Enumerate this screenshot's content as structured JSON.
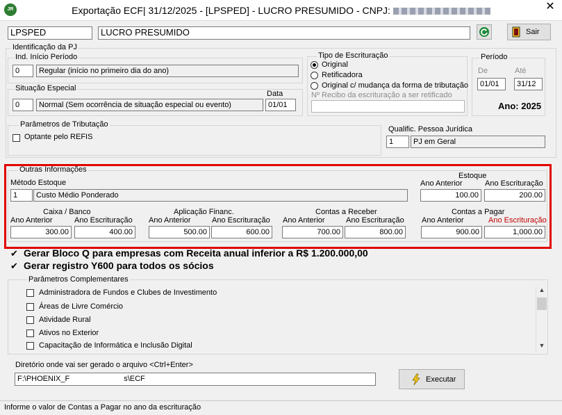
{
  "titlebar": {
    "icon_text": "JR",
    "title": "Exportação ECF| 31/12/2025 - [LPSPED] - LUCRO PRESUMIDO - CNPJ:",
    "close": "✕"
  },
  "header": {
    "code": "LPSPED",
    "name": "LUCRO PRESUMIDO",
    "exit_button": "Sair"
  },
  "identificacao": {
    "legend": "Identificação da PJ",
    "ind_inicio": {
      "legend": "Ind. Início Período",
      "code": "0",
      "desc": "Regular (início no primeiro dia do ano)"
    },
    "situacao": {
      "legend": "Situação Especial",
      "date_label": "Data",
      "code": "0",
      "desc": "Normal (Sem ocorrência de situação especial ou evento)",
      "date": "01/01"
    },
    "tipo": {
      "legend": "Tipo de Escrituração",
      "options": [
        "Original",
        "Retificadora",
        "Original c/ mudança da forma de tributação"
      ],
      "selected": 0,
      "recibo_label": "Nº Recibo da escrituração a ser retificado",
      "recibo_value": ""
    },
    "periodo": {
      "legend": "Período",
      "de_label": "De",
      "ate_label": "Até",
      "de": "01/01",
      "ate": "31/12",
      "ano": "Ano: 2025"
    }
  },
  "tributacao": {
    "legend": "Parâmetros de Tributação",
    "refis_label": "Optante pelo REFIS",
    "refis_checked": false,
    "qualif_label": "Qualific. Pessoa Jurídica",
    "qualif_code": "1",
    "qualif_desc": "PJ em Geral"
  },
  "outras": {
    "legend": "Outras Informações",
    "metodo_label": "Método Estoque",
    "metodo_code": "1",
    "metodo_desc": "Custo Médio Ponderado",
    "estoque": {
      "title": "Estoque",
      "ant_label": "Ano Anterior",
      "esc_label": "Ano Escrituração",
      "ant": "100.00",
      "esc": "200.00"
    },
    "caixa": {
      "title": "Caixa / Banco",
      "ant_label": "Ano  Anterior",
      "esc_label": "Ano Escrituração",
      "ant": "300.00",
      "esc": "400.00"
    },
    "aplicacao": {
      "title": "Aplicação Financ.",
      "ant_label": "Ano  Anterior",
      "esc_label": "Ano Escrituração",
      "ant": "500.00",
      "esc": "600.00"
    },
    "receber": {
      "title": "Contas a Receber",
      "ant_label": "Ano Anterior",
      "esc_label": "Ano Escrituração",
      "ant": "700.00",
      "esc": "800.00"
    },
    "pagar": {
      "title": "Contas a Pagar",
      "ant_label": "Ano Anterior",
      "esc_label": "Ano Escrituração",
      "ant": "900.00",
      "esc": "1,000.00"
    }
  },
  "checks": {
    "bloco_q": "Gerar Bloco Q para empresas com Receita anual inferior a R$ 1.200.000,00",
    "bloco_q_checked": true,
    "y600": "Gerar registro Y600 para todos os sócios",
    "y600_checked": true
  },
  "complementares": {
    "legend": "Parâmetros Complementares",
    "items": [
      "Administradora de Fundos e Clubes de Investimento",
      "Áreas de Livre Comércio",
      "Atividade Rural",
      "Ativos no Exterior",
      "Capacitação de Informática e Inclusão Digital"
    ]
  },
  "diretorio": {
    "label": "Diretório onde vai ser gerado o arquivo <Ctrl+Enter>",
    "value_start": "F:\\PHOENIX_F",
    "value_end": "s\\ECF",
    "exec_button": "Executar"
  },
  "status": "Informe o valor de Contas a Pagar no ano da escrituração",
  "colors": {
    "highlight": "#e00000",
    "label_red": "#c00000",
    "icon_green": "#2e7d32"
  }
}
